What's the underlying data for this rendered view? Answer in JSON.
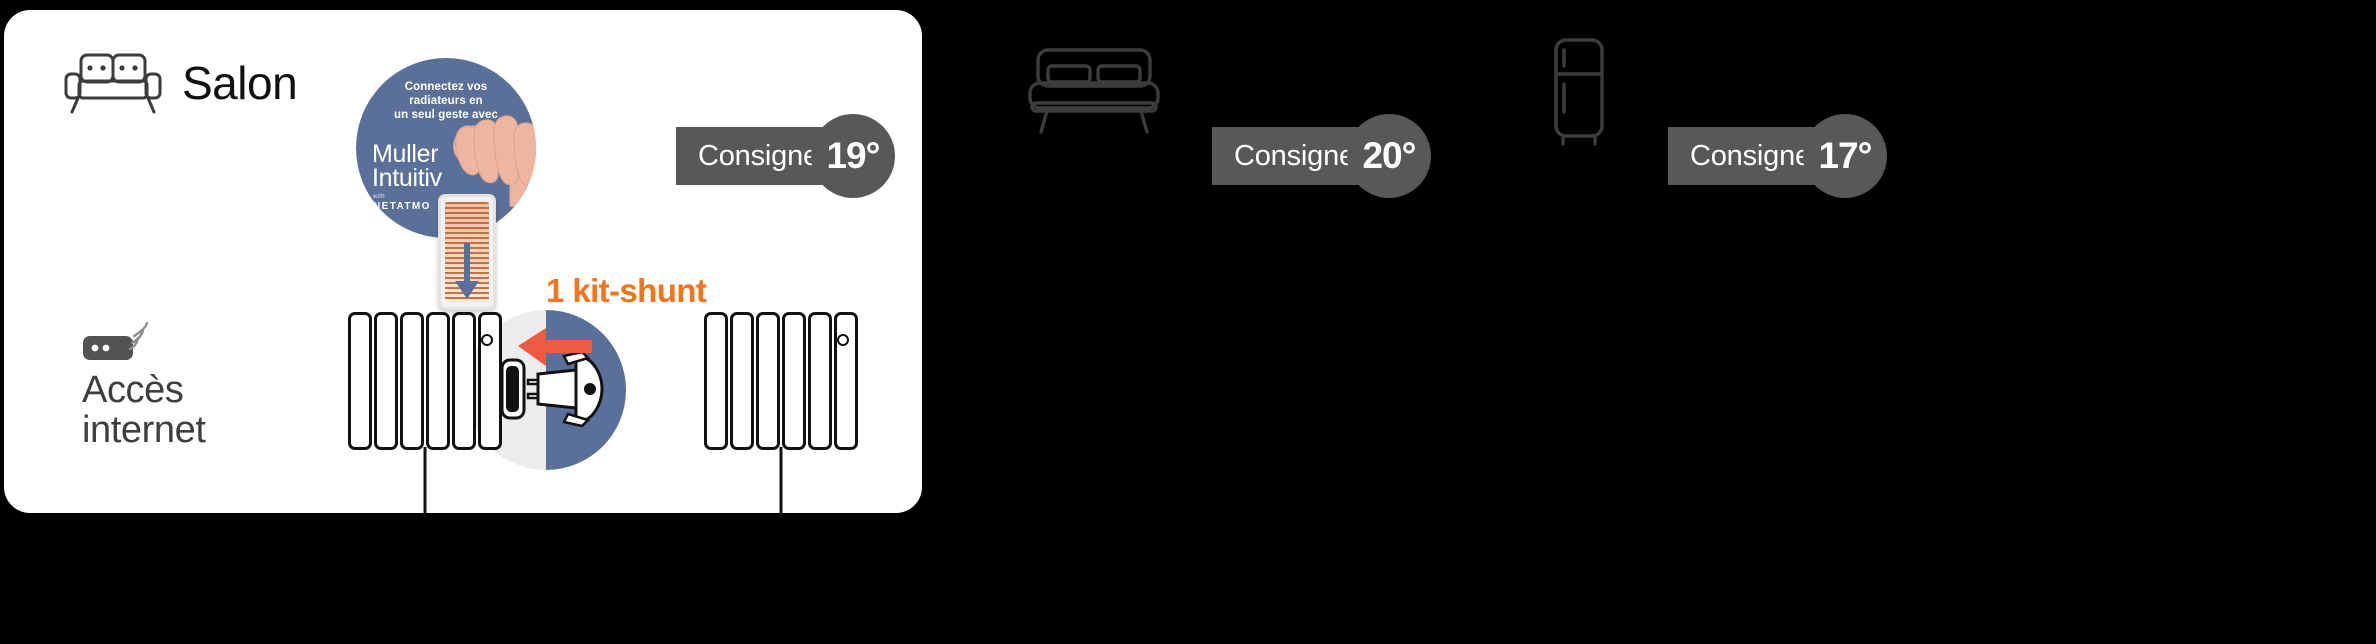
{
  "room": {
    "name": "Salon",
    "sofa_icon": "sofa-icon",
    "internet": {
      "icon": "router-wifi-icon",
      "line1": "Accès",
      "line2": "internet"
    }
  },
  "promo": {
    "headline": "Connectez vos\nradiateurs en\nun seul geste avec",
    "brand_line1": "Muller",
    "brand_line2": "Intuitiv",
    "with": "with",
    "partner": "NETATMO",
    "circle_color": "#5b7099"
  },
  "kit": {
    "label": "1 kit-shunt",
    "label_color": "#f2741c",
    "arrow_color": "#ec5b42"
  },
  "radiators": [
    {
      "name": "radiator-left",
      "fins": 6
    },
    {
      "name": "radiator-right",
      "fins": 6
    }
  ],
  "rooms_other": [
    {
      "icon": "bed-icon",
      "name": "bedroom"
    },
    {
      "icon": "fridge-icon",
      "name": "kitchen"
    }
  ],
  "badges": [
    {
      "label": "Consigne",
      "value": "19°",
      "color": "#585856"
    },
    {
      "label": "Consigne",
      "value": "20°",
      "color": "#585856"
    },
    {
      "label": "Consigne",
      "value": "17°",
      "color": "#585856"
    }
  ]
}
